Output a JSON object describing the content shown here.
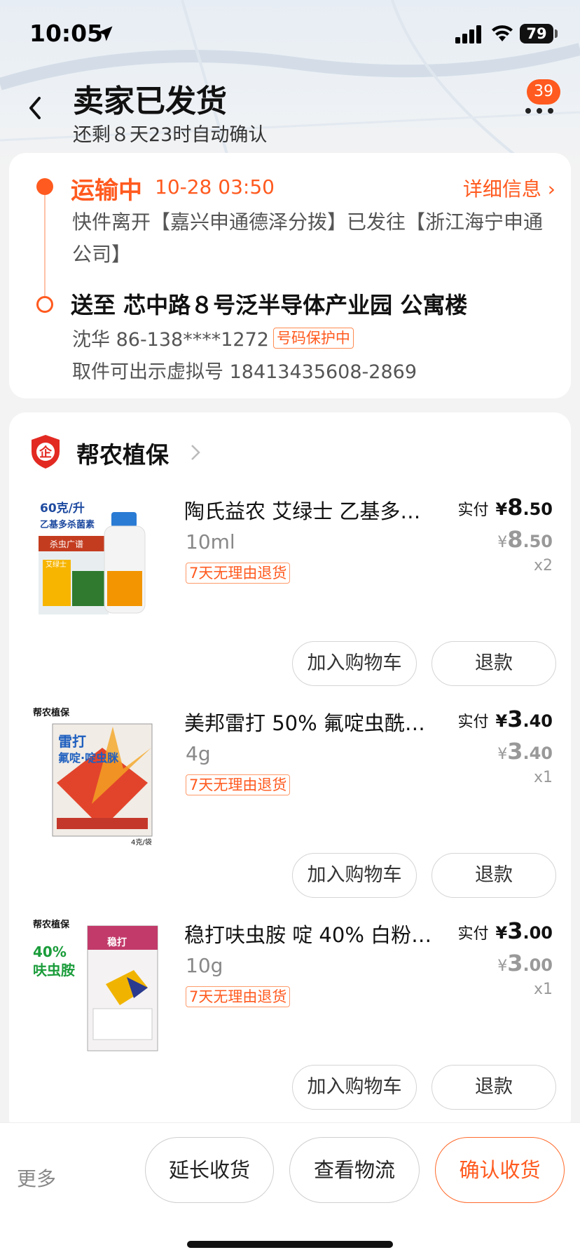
{
  "status_bar": {
    "time": "10:05",
    "battery": "79"
  },
  "header": {
    "title": "卖家已发货",
    "subtitle": "还剩８天23时自动确认",
    "message_count": "39"
  },
  "logistics": {
    "status": "运输中",
    "time": "10-28 03:50",
    "detail_link": "详细信息 ›",
    "description": "快件离开【嘉兴申通德泽分拨】已发往【浙江海宁申通公司】",
    "address": "送至 芯中路８号泛半导体产业园 公寓楼",
    "contact": "沈华 86-138****1272",
    "protect_tag": "号码保护中",
    "pickup": "取件可出示虚拟号 18413435608-2869"
  },
  "shop": {
    "name": "帮农植保",
    "logo_char": "企"
  },
  "items": [
    {
      "title": "陶氏益农 艾绿士 乙基多…",
      "spec": "10ml",
      "tag": "7天无理由退货",
      "paid_label": "实付",
      "currency": "¥",
      "paid_int": "8",
      "paid_dec": ".50",
      "orig_int": "8",
      "orig_dec": ".50",
      "qty": "x2",
      "cart_label": "加入购物车",
      "refund_label": "退款",
      "img_text": {
        "line1": "60克/升",
        "line2": "乙基多杀菌素",
        "line3": "杀虫广谱",
        "brand": "艾绿士"
      }
    },
    {
      "title": "美邦雷打 50% 氟啶虫酰…",
      "spec": "4g",
      "tag": "7天无理由退货",
      "paid_label": "实付",
      "currency": "¥",
      "paid_int": "3",
      "paid_dec": ".40",
      "orig_int": "3",
      "orig_dec": ".40",
      "qty": "x1",
      "cart_label": "加入购物车",
      "refund_label": "退款",
      "img_text": {
        "line1": "帮农植保",
        "line2": "雷打",
        "line3": "氟啶·啶虫脒",
        "brand": "4克/袋"
      }
    },
    {
      "title": "稳打呋虫胺 啶 40% 白粉…",
      "spec": "10g",
      "tag": "7天无理由退货",
      "paid_label": "实付",
      "currency": "¥",
      "paid_int": "3",
      "paid_dec": ".00",
      "orig_int": "3",
      "orig_dec": ".00",
      "qty": "x1",
      "cart_label": "加入购物车",
      "refund_label": "退款",
      "img_text": {
        "line1": "帮农植保",
        "line2": "40%",
        "line3": "呋虫胺",
        "brand": "稳打"
      }
    }
  ],
  "bottom_bar": {
    "more": "更多",
    "extend": "延长收货",
    "track": "查看物流",
    "confirm": "确认收货"
  },
  "colors": {
    "accent": "#ff5a1f",
    "card": "#ffffff",
    "background": "#f3f3f3"
  }
}
